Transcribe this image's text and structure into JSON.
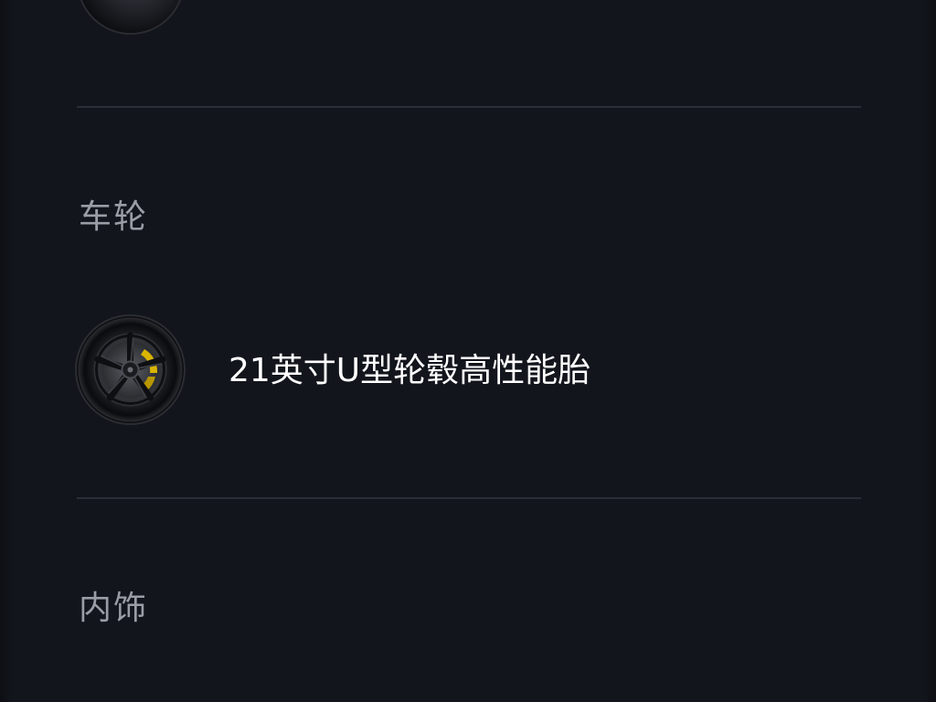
{
  "sections": {
    "wheels": {
      "title": "车轮",
      "option": {
        "label": "21英寸U型轮毂高性能胎",
        "thumbnail_icon": "wheel-thumbnail-icon",
        "caliper_color": "#d9b400"
      }
    },
    "interior": {
      "title": "内饰"
    }
  },
  "colors": {
    "background": "#12151c",
    "divider": "#2a2e36",
    "section_title": "#9a9da5",
    "option_text": "#ffffff"
  }
}
